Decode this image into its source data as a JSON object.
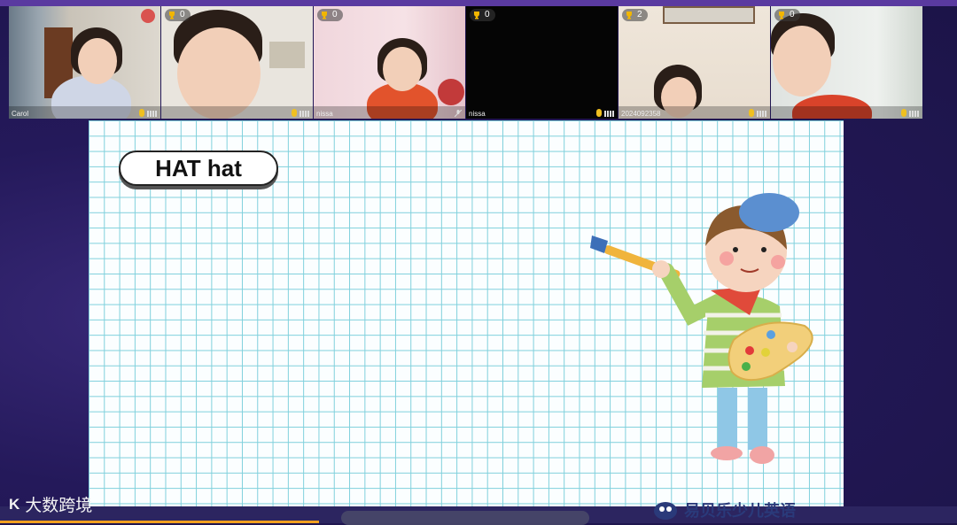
{
  "participants": [
    {
      "name": "Carol",
      "score": "",
      "muted_badge": true
    },
    {
      "name": "",
      "score": "0",
      "muted_badge": false
    },
    {
      "name": "nissa",
      "score": "0",
      "muted_badge": false
    },
    {
      "name": "nissa",
      "score": "0",
      "muted_badge": false
    },
    {
      "name": "2024092358",
      "score": "2",
      "muted_badge": false
    },
    {
      "name": "",
      "score": "0",
      "muted_badge": false
    }
  ],
  "board": {
    "word": "HAT hat"
  },
  "watermark": {
    "left_text": "大数跨境",
    "left_logo": "K"
  },
  "brand": {
    "text": "易贝乐少儿英语"
  },
  "colors": {
    "grid": "#7fd0dc",
    "accent": "#f0a020"
  }
}
